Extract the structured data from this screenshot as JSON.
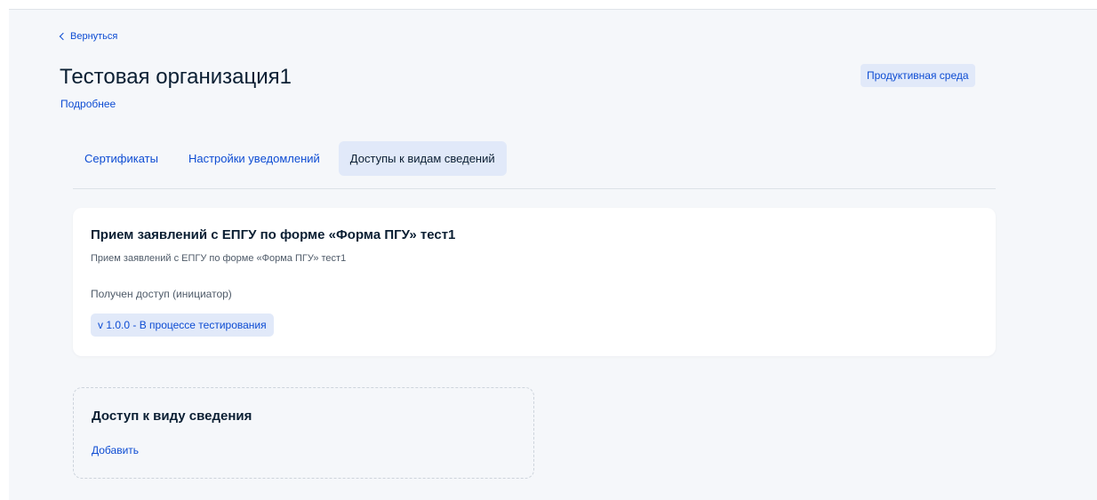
{
  "nav": {
    "back_label": "Вернуться"
  },
  "header": {
    "title": "Тестовая организация1",
    "details_link": "Подробнее",
    "environment_badge": "Продуктивная среда"
  },
  "tabs": [
    {
      "label": "Сертификаты",
      "active": false
    },
    {
      "label": "Настройки уведомлений",
      "active": false
    },
    {
      "label": "Доступы к видам сведений",
      "active": true
    }
  ],
  "info_card": {
    "title": "Прием заявлений с ЕПГУ по форме «Форма ПГУ» тест1",
    "subtitle": "Прием заявлений с ЕПГУ по форме «Форма ПГУ» тест1",
    "access_status": "Получен доступ (инициатор)",
    "version_tag": "v 1.0.0 - В процессе тестирования"
  },
  "add_card": {
    "title": "Доступ к виду сведения",
    "add_link": "Добавить"
  },
  "colors": {
    "accent": "#0d4cd3",
    "text": "#0b1f33",
    "background": "#f5f7fa",
    "badge_bg": "#e1e9f9"
  }
}
